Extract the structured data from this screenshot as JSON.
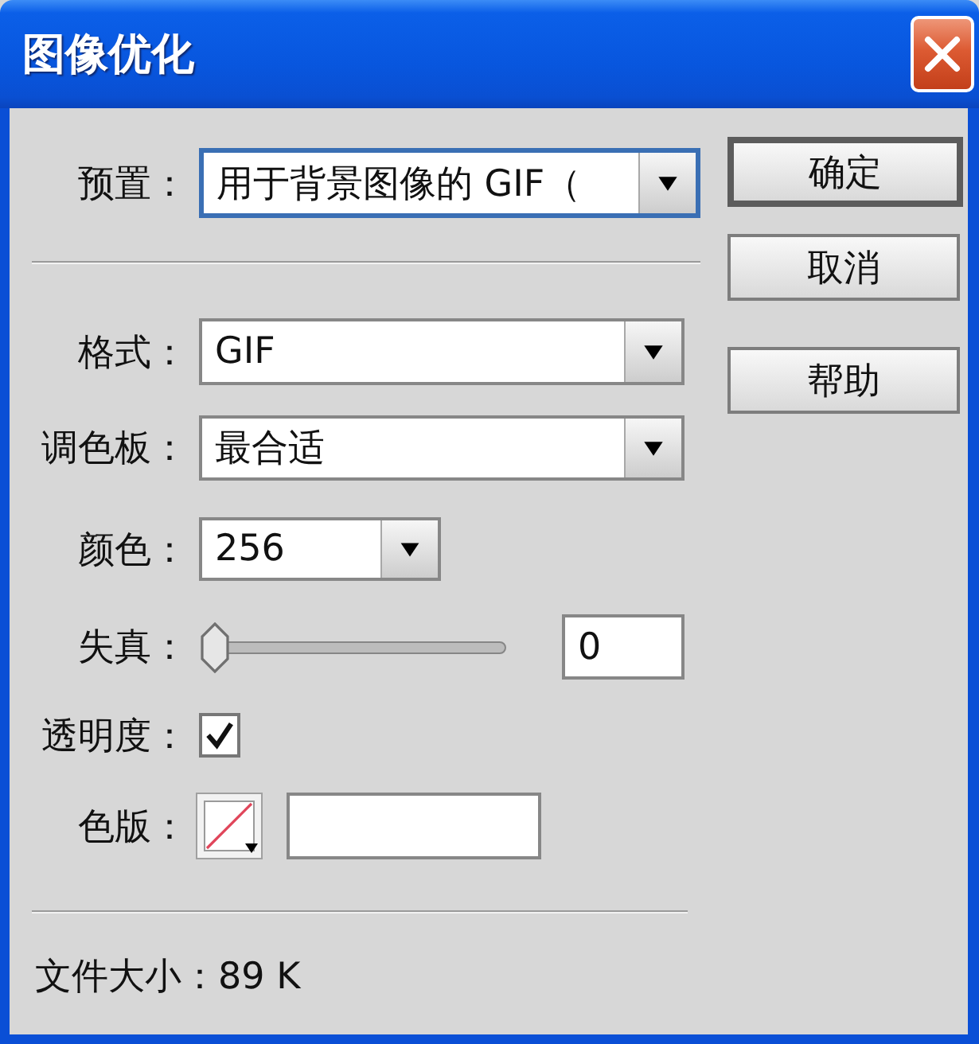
{
  "window": {
    "title": "图像优化"
  },
  "preset": {
    "label": "预置：",
    "value": "用于背景图像的 GIF（",
    "focused": true
  },
  "buttons": [
    {
      "label": "确定",
      "default": true
    },
    {
      "label": "取消",
      "default": false
    },
    {
      "label": "帮助",
      "default": false
    }
  ],
  "format": {
    "label": "格式：",
    "value": "GIF"
  },
  "palette": {
    "label": "调色板：",
    "value": "最合适"
  },
  "colors": {
    "label": "颜色：",
    "value": "256"
  },
  "dither": {
    "label": "失真：",
    "level": 0,
    "value": "0"
  },
  "transparency": {
    "label": "透明度：",
    "checked": true
  },
  "matte": {
    "label": "色版："
  },
  "status": "文件大小：89 K"
}
